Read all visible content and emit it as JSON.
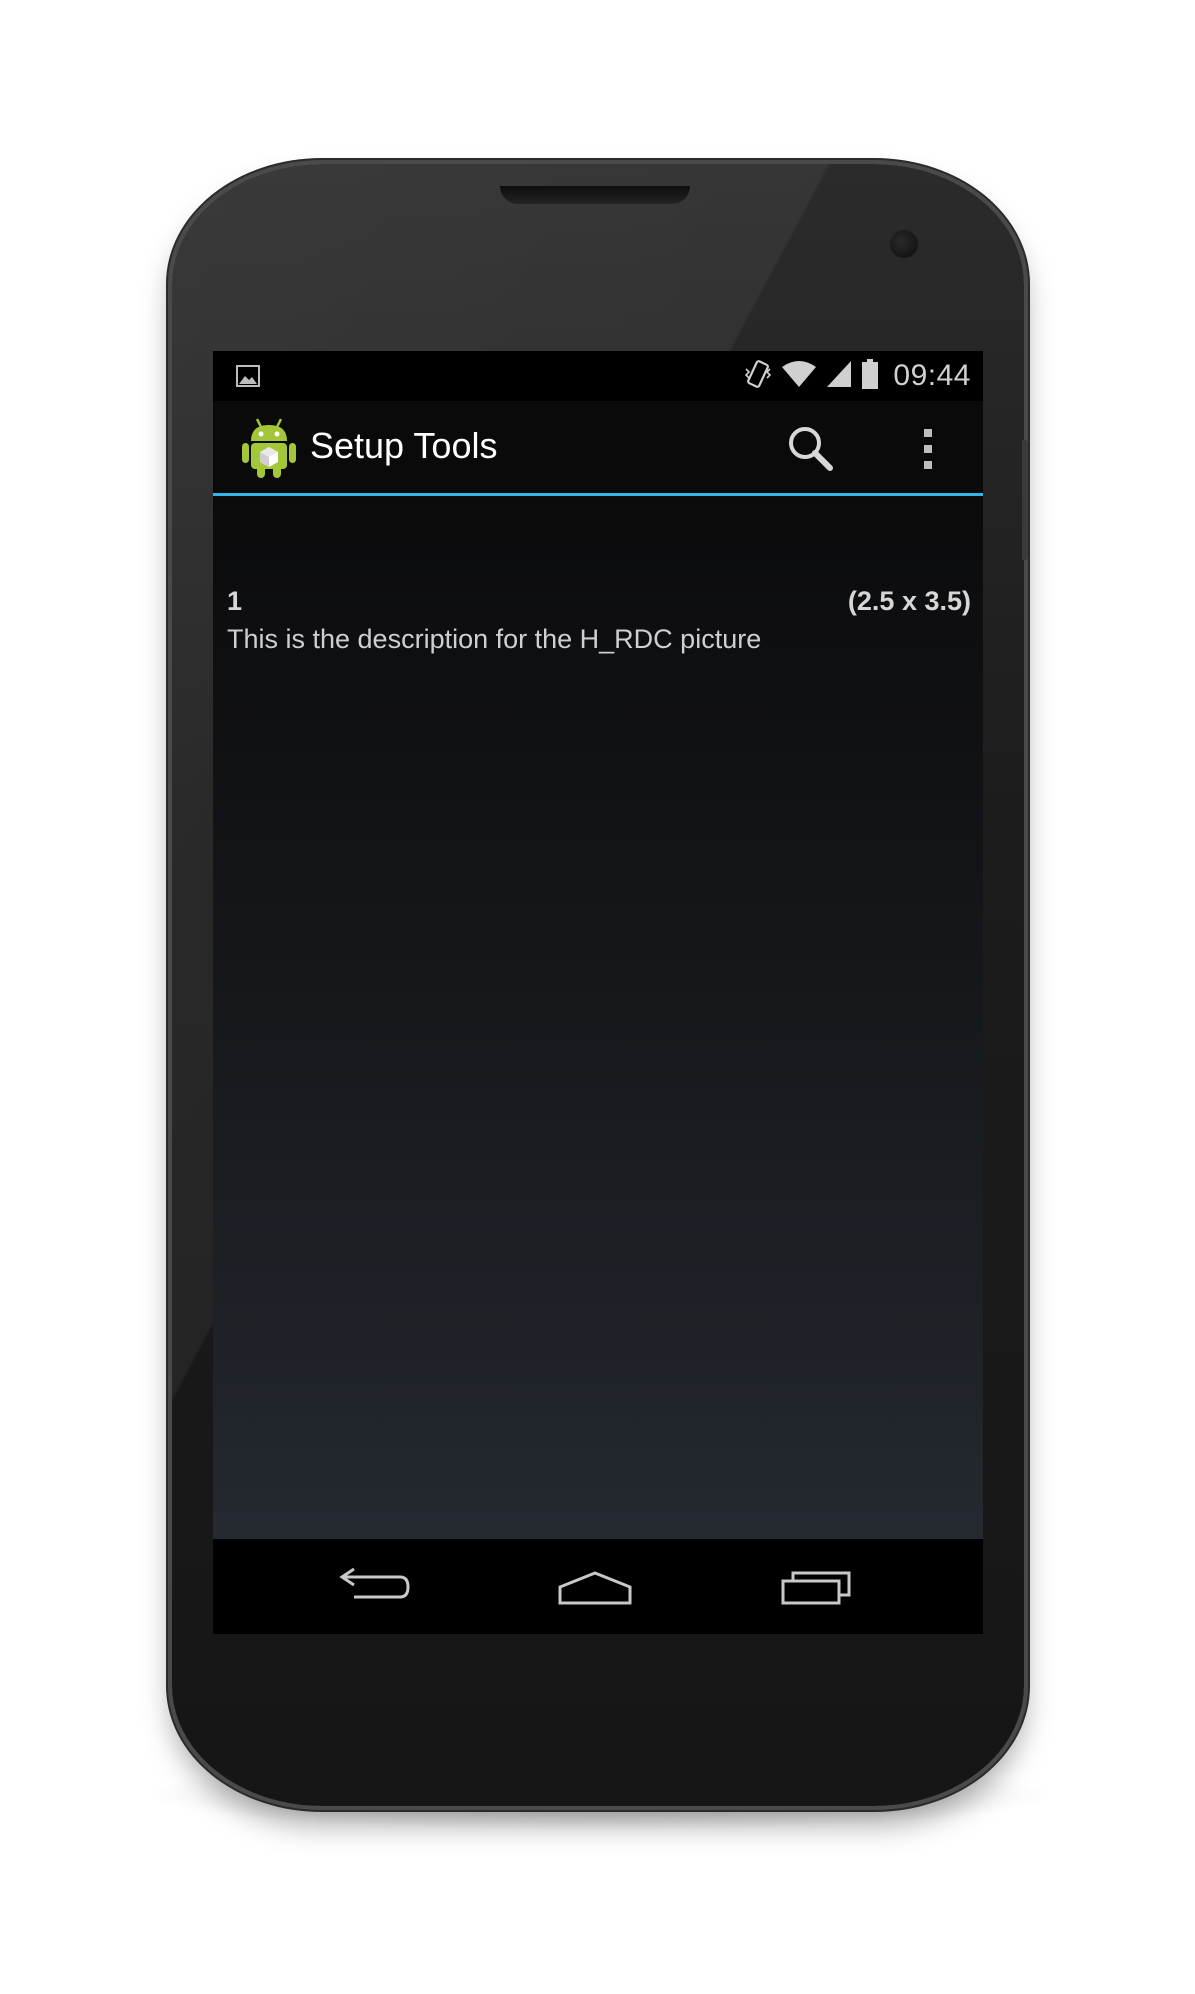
{
  "status_bar": {
    "time": "09:44",
    "icons": [
      "picture-notification-icon",
      "vibrate-icon",
      "wifi-icon",
      "signal-icon",
      "battery-icon"
    ]
  },
  "action_bar": {
    "title": "Setup Tools",
    "app_icon": "android-app-icon",
    "actions": [
      "search-icon",
      "overflow-menu-icon"
    ],
    "accent_color": "#33b5e5"
  },
  "list": {
    "items": [
      {
        "number": "1",
        "size": "(2.5 x 3.5)",
        "description": "This is the description for the H_RDC picture"
      }
    ]
  },
  "nav_bar": {
    "buttons": [
      "back-icon",
      "home-icon",
      "recents-icon"
    ]
  }
}
